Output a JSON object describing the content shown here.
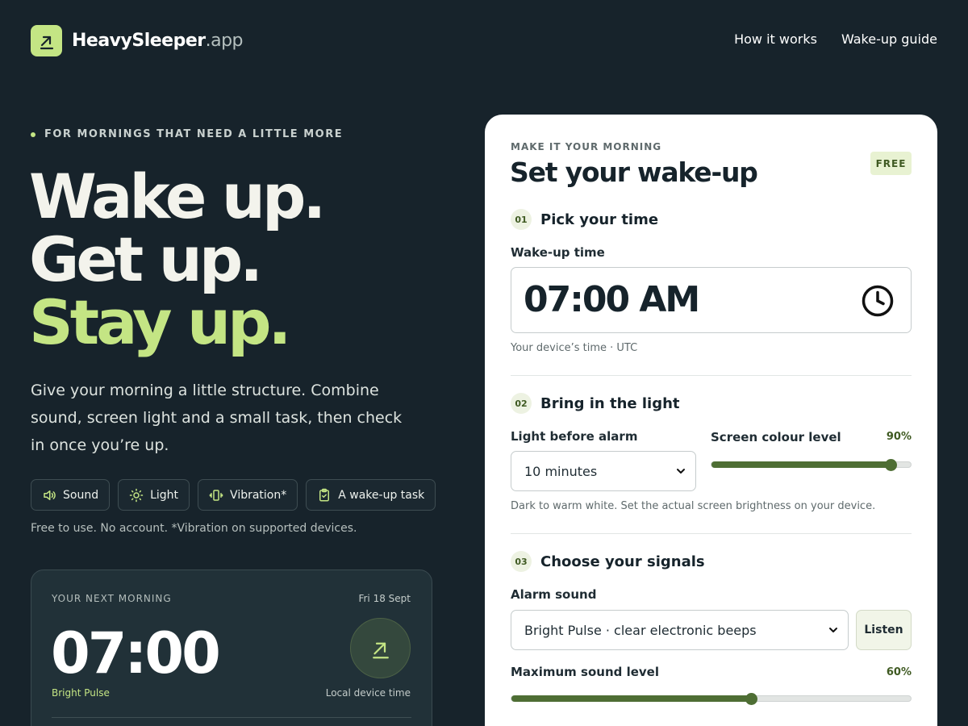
{
  "header": {
    "brand_name": "HeavySleeper",
    "brand_tld": ".app",
    "nav": [
      {
        "label": "How it works"
      },
      {
        "label": "Wake-up guide"
      }
    ]
  },
  "hero": {
    "eyebrow": "FOR MORNINGS THAT NEED A LITTLE MORE",
    "headline_1": "Wake up.",
    "headline_2": "Get up.",
    "headline_3": "Stay up.",
    "lede": "Give your morning a little structure. Combine sound, screen light and a small task, then check in once you’re up.",
    "chips": [
      {
        "label": "Sound",
        "icon": "speaker-icon"
      },
      {
        "label": "Light",
        "icon": "sun-icon"
      },
      {
        "label": "Vibration*",
        "icon": "vibration-icon"
      },
      {
        "label": "A wake-up task",
        "icon": "clipboard-check-icon"
      }
    ],
    "note": "Free to use. No account. *Vibration on supported devices."
  },
  "next_morning": {
    "label": "YOUR NEXT MORNING",
    "date": "Fri 18 Sept",
    "time": "07:00",
    "sound": "Bright Pulse",
    "clock_note": "Local device time"
  },
  "panel": {
    "eyebrow": "MAKE IT YOUR MORNING",
    "title": "Set your wake-up",
    "badge": "FREE",
    "step1": {
      "num": "01",
      "title": "Pick your time",
      "field_label": "Wake-up time",
      "value": "07:00 AM",
      "hint": "Your device’s time · UTC"
    },
    "step2": {
      "num": "02",
      "title": "Bring in the light",
      "light_label": "Light before alarm",
      "light_value": "10 minutes",
      "colour_label": "Screen colour level",
      "colour_pct_text": "90%",
      "colour_level": 0.9,
      "hint": "Dark to warm white. Set the actual screen brightness on your device."
    },
    "step3": {
      "num": "03",
      "title": "Choose your signals",
      "sound_label": "Alarm sound",
      "sound_value": "Bright Pulse · clear electronic beeps",
      "listen": "Listen",
      "level_label": "Maximum sound level",
      "level_pct_text": "60%",
      "level": 0.6
    }
  },
  "colors": {
    "accent": "#c4e584",
    "background": "#17232b",
    "slider": "#4e6e34"
  }
}
